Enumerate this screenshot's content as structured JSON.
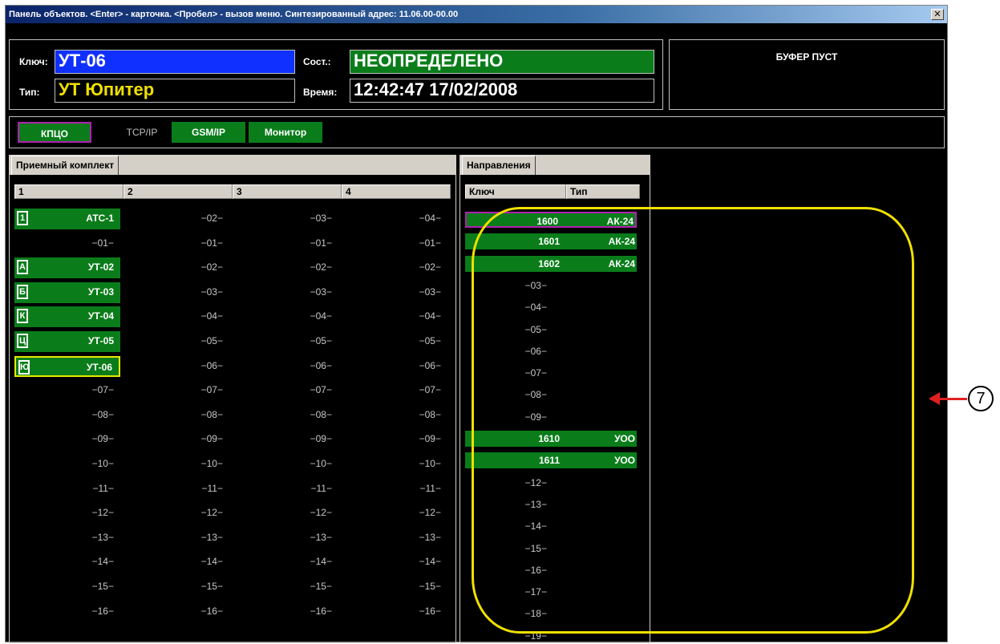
{
  "window": {
    "title": "Панель объектов. <Enter> - карточка. <Пробел> - вызов меню. Синтезированный адрес: 11.06.00-00.00",
    "close_label": "✕"
  },
  "info": {
    "key_label": "Ключ:",
    "key_value": "УТ-06",
    "type_label": "Тип:",
    "type_value": "УТ Юпитер",
    "state_label": "Сост.:",
    "state_value": "НЕОПРЕДЕЛЕНО",
    "time_label": "Время:",
    "time_value": "12:42:47 17/02/2008",
    "buffer_text": "БУФЕР ПУСТ"
  },
  "channels": [
    {
      "label": "КПЦО",
      "style": "green-selected"
    },
    {
      "label": "TCP/IP",
      "style": "plain"
    },
    {
      "label": "GSM/IP",
      "style": "green"
    },
    {
      "label": "Монитор",
      "style": "green"
    }
  ],
  "receiver": {
    "tab_label": "Приемный комплект",
    "columns": [
      "1",
      "2",
      "3",
      "4"
    ],
    "rows": [
      [
        "АТС-1",
        "−02−",
        "−03−",
        "−04−"
      ],
      [
        "−01−",
        "−01−",
        "−01−",
        "−01−"
      ],
      [
        "УТ-02",
        "−02−",
        "−02−",
        "−02−"
      ],
      [
        "УТ-03",
        "−03−",
        "−03−",
        "−03−"
      ],
      [
        "УТ-04",
        "−04−",
        "−04−",
        "−04−"
      ],
      [
        "УТ-05",
        "−05−",
        "−05−",
        "−05−"
      ],
      [
        "УТ-06",
        "−06−",
        "−06−",
        "−06−"
      ],
      [
        "−07−",
        "−07−",
        "−07−",
        "−07−"
      ],
      [
        "−08−",
        "−08−",
        "−08−",
        "−08−"
      ],
      [
        "−09−",
        "−09−",
        "−09−",
        "−09−"
      ],
      [
        "−10−",
        "−10−",
        "−10−",
        "−10−"
      ],
      [
        "−11−",
        "−11−",
        "−11−",
        "−11−"
      ],
      [
        "−12−",
        "−12−",
        "−12−",
        "−12−"
      ],
      [
        "−13−",
        "−13−",
        "−13−",
        "−13−"
      ],
      [
        "−14−",
        "−14−",
        "−14−",
        "−14−"
      ],
      [
        "−15−",
        "−15−",
        "−15−",
        "−15−"
      ],
      [
        "−16−",
        "−16−",
        "−16−",
        "−16−"
      ]
    ],
    "row_tags": [
      "1",
      "",
      "А",
      "Б",
      "К",
      "Ц",
      "Ю",
      "",
      "",
      "",
      "",
      "",
      "",
      "",
      "",
      "",
      ""
    ],
    "green_rows": [
      0,
      2,
      3,
      4,
      5,
      6
    ],
    "selected_row": 6
  },
  "directions": {
    "tab_label": "Направления",
    "col_key": "Ключ",
    "col_type": "Тип",
    "rows": [
      {
        "key": "1600",
        "type": "АК-24",
        "green": true,
        "selected": true
      },
      {
        "key": "1601",
        "type": "АК-24",
        "green": true
      },
      {
        "key": "1602",
        "type": "АК-24",
        "green": true
      },
      {
        "key": "−03−",
        "type": ""
      },
      {
        "key": "−04−",
        "type": ""
      },
      {
        "key": "−05−",
        "type": ""
      },
      {
        "key": "−06−",
        "type": ""
      },
      {
        "key": "−07−",
        "type": ""
      },
      {
        "key": "−08−",
        "type": ""
      },
      {
        "key": "−09−",
        "type": ""
      },
      {
        "key": "1610",
        "type": "УОО",
        "green": true
      },
      {
        "key": "1611",
        "type": "УОО",
        "green": true
      },
      {
        "key": "−12−",
        "type": ""
      },
      {
        "key": "−13−",
        "type": ""
      },
      {
        "key": "−14−",
        "type": ""
      },
      {
        "key": "−15−",
        "type": ""
      },
      {
        "key": "−16−",
        "type": ""
      },
      {
        "key": "−17−",
        "type": ""
      },
      {
        "key": "−18−",
        "type": ""
      },
      {
        "key": "−19−",
        "type": ""
      }
    ]
  },
  "annotation": {
    "callout_number": "7",
    "oval_color": "#f0e000",
    "arrow_color": "#e02020"
  },
  "colors": {
    "green": "#0a7d1a",
    "blue_field": "#1030ff",
    "magenta": "#b020b0",
    "yellow": "#e8e800"
  }
}
